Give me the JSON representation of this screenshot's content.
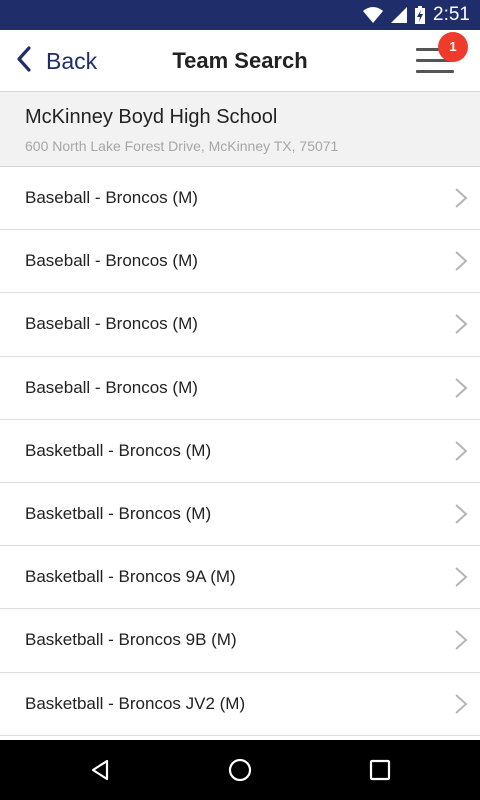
{
  "status_bar": {
    "time": "2:51",
    "icons": [
      "wifi-icon",
      "cell-signal-icon",
      "battery-charging-icon"
    ]
  },
  "header": {
    "back_label": "Back",
    "title": "Team Search",
    "menu_icon": "hamburger-menu-icon",
    "notification_count": "1",
    "accent_color": "#1f2d6a",
    "badge_color": "#ef3b2c"
  },
  "school": {
    "name": "McKinney Boyd High School",
    "address": "600 North Lake Forest Drive, McKinney TX, 75071"
  },
  "teams": [
    {
      "label": "Baseball - Broncos (M)"
    },
    {
      "label": "Baseball - Broncos (M)"
    },
    {
      "label": "Baseball - Broncos (M)"
    },
    {
      "label": "Baseball - Broncos (M)"
    },
    {
      "label": "Basketball - Broncos (M)"
    },
    {
      "label": "Basketball - Broncos (M)"
    },
    {
      "label": "Basketball - Broncos 9A (M)"
    },
    {
      "label": "Basketball - Broncos 9B (M)"
    },
    {
      "label": "Basketball - Broncos JV2 (M)"
    }
  ],
  "nav_bar": {
    "icons": [
      "back-triangle-icon",
      "home-circle-icon",
      "recents-square-icon"
    ]
  }
}
